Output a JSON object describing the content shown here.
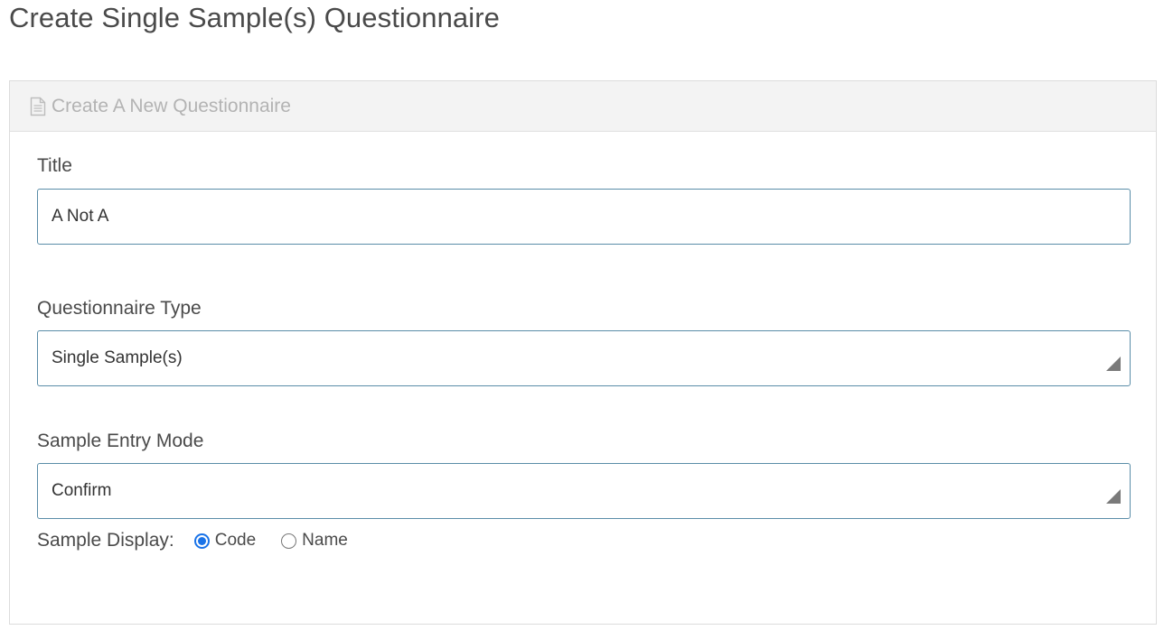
{
  "page": {
    "title": "Create Single Sample(s) Questionnaire"
  },
  "panel": {
    "heading": "Create A New Questionnaire",
    "heading_icon": "document-icon"
  },
  "form": {
    "title": {
      "label": "Title",
      "value": "A Not A"
    },
    "questionnaire_type": {
      "label": "Questionnaire Type",
      "selected": "Single Sample(s)"
    },
    "sample_entry_mode": {
      "label": "Sample Entry Mode",
      "selected": "Confirm"
    },
    "sample_display": {
      "label": "Sample Display:",
      "options": [
        {
          "label": "Code",
          "checked": true
        },
        {
          "label": "Name",
          "checked": false
        }
      ]
    }
  },
  "colors": {
    "accent": "#1a73e8",
    "field_border": "#5a8da8",
    "heading_bg": "#f3f3f3"
  }
}
